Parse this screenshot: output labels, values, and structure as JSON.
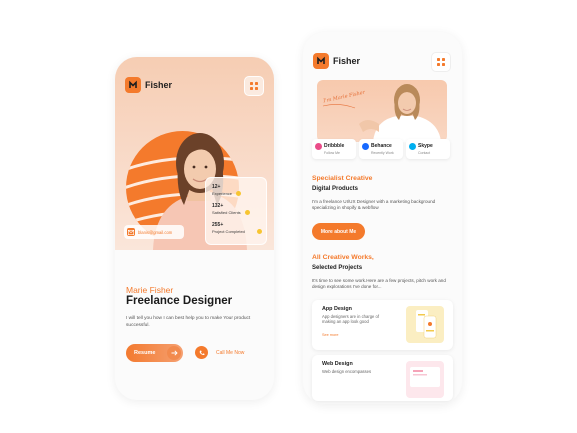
{
  "left_phone": {
    "brand": "Fisher",
    "stats": [
      {
        "num": "12+",
        "label": "Experience"
      },
      {
        "num": "132+",
        "label": "Satisfied Clients"
      },
      {
        "num": "255+",
        "label": "Project Completed"
      }
    ],
    "email": "blanis@gmail.com",
    "name": "Marie Fisher",
    "title": "Freelance Designer",
    "description": "I will tell you how I can best help you to make Your product successful.",
    "resume_label": "Resume",
    "call_label": "Call Me Now"
  },
  "right_phone": {
    "brand": "Fisher",
    "banner_script": "I'm Marie Fisher",
    "socials": [
      {
        "name": "Dribbble",
        "sub": "Follow Me",
        "color": "#ea4c89"
      },
      {
        "name": "Behance",
        "sub": "Recently Work",
        "color": "#1769ff"
      },
      {
        "name": "Skype",
        "sub": "Contact",
        "color": "#00aff0"
      }
    ],
    "section1": {
      "kicker": "Specialist Creative",
      "title": "Digital Products",
      "description": "I'm a freelance UI/UX Designer with a marketing background specializing in shopify & webflow",
      "button": "More about Me"
    },
    "section2": {
      "kicker": "All Creative Works,",
      "title": "Selected Projects",
      "description": "It's time to see some work.Here are a few projects, pitch work and design explorations I've done for..."
    },
    "works": [
      {
        "title": "App Design",
        "description": "App designers are in charge of making an app look good",
        "link": "See more"
      },
      {
        "title": "Web Design",
        "description": "Web design encompasses",
        "link": ""
      }
    ]
  },
  "colors": {
    "accent": "#f47a2c",
    "peach": "#f7cbb0"
  }
}
